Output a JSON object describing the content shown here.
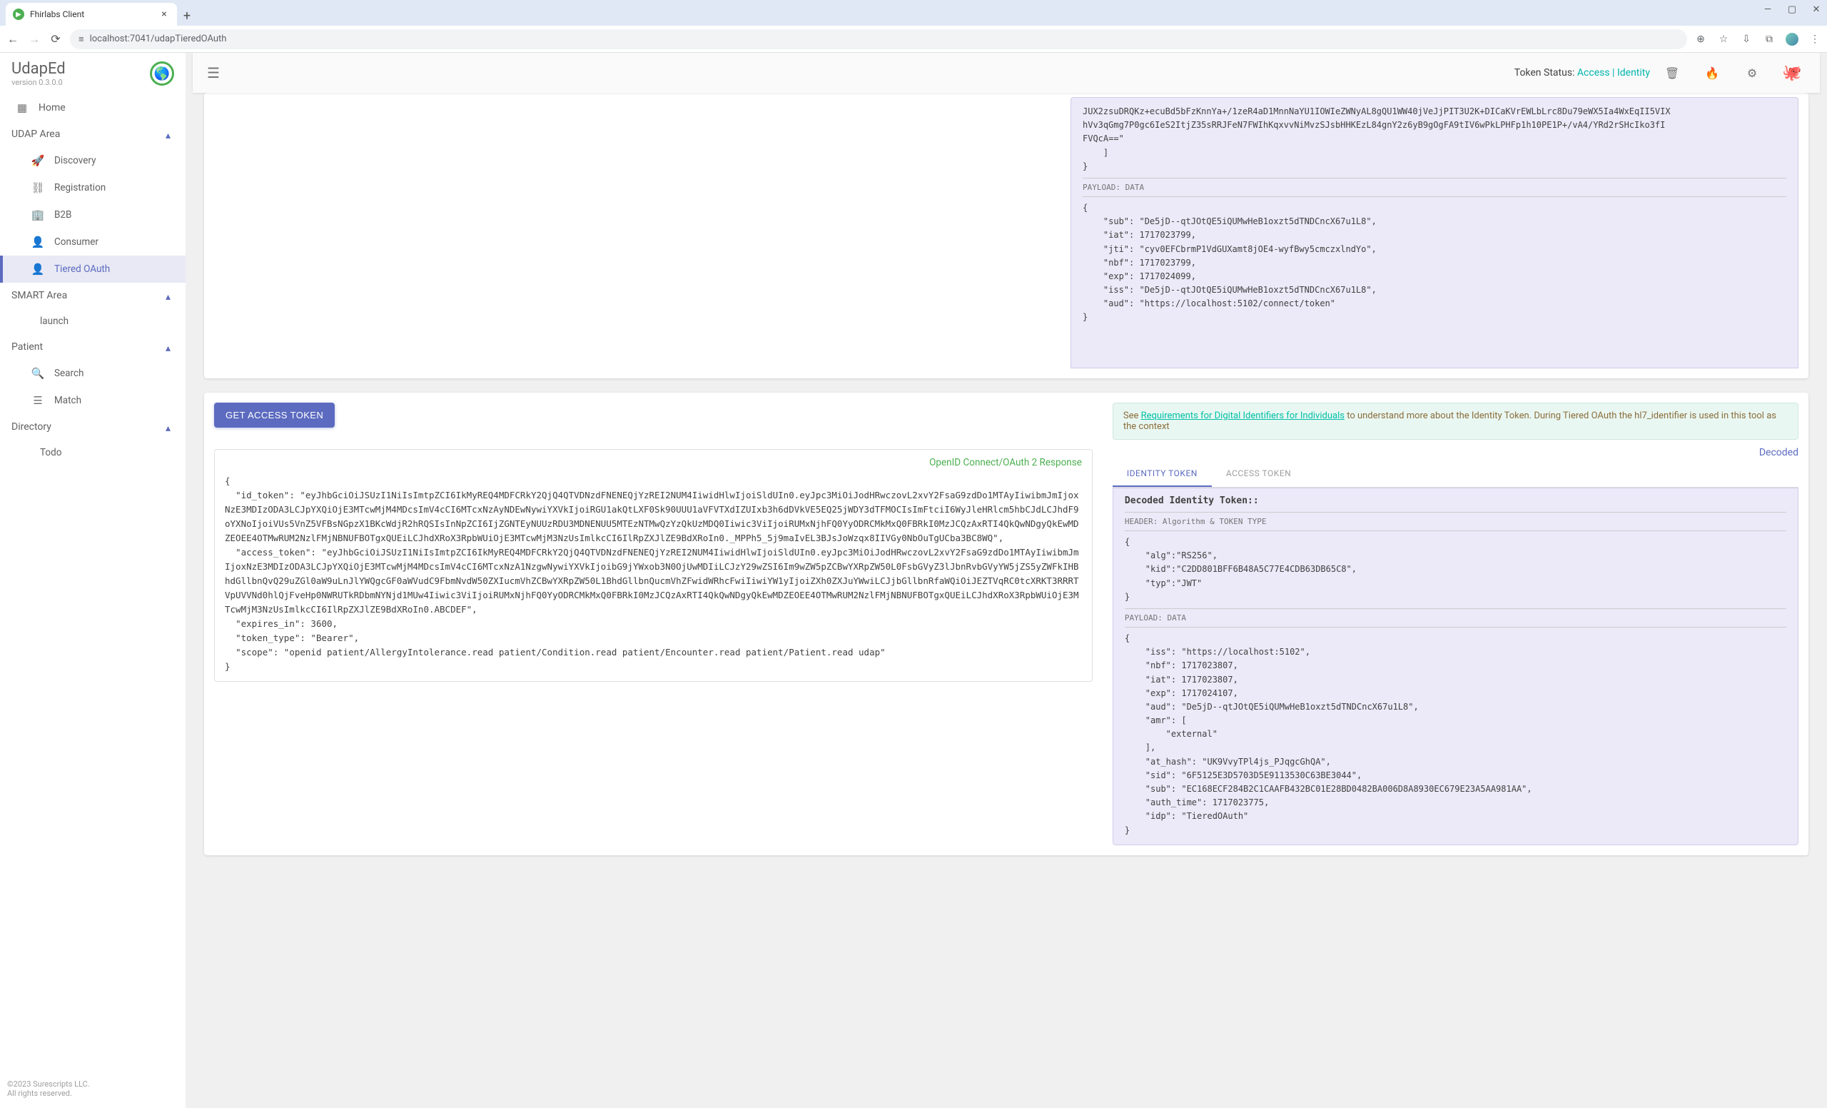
{
  "browser": {
    "tab_title": "Fhirlabs Client",
    "url": "localhost:7041/udapTieredOAuth"
  },
  "brand": {
    "name": "UdapEd",
    "version": "version 0.3.0.0"
  },
  "sidebar": {
    "home": "Home",
    "groups": {
      "udap": "UDAP Area",
      "smart": "SMART Area",
      "patient": "Patient",
      "directory": "Directory"
    },
    "items": {
      "discovery": "Discovery",
      "registration": "Registration",
      "b2b": "B2B",
      "consumer": "Consumer",
      "tiered": "Tiered OAuth",
      "launch": "launch",
      "search": "Search",
      "match": "Match",
      "todo": "Todo"
    }
  },
  "footer": {
    "line1": "©2023 Surescripts LLC.",
    "line2": "All rights reserved."
  },
  "appbar": {
    "token_status_label": "Token Status: ",
    "token_status_value": "Access | Identity"
  },
  "top_decoded": {
    "sig_fragment": "JUX2zsuDRQKz+ecuBd5bFzKnnYa+/1zeR4aD1MnnNaYU1IOWIeZWNyAL8gQU1WW40jVeJjPIT3U2K+DICaKVrEWLbLrc8Du79eWX5Ia4WxEqII5VIX\nhVv3qGmg7P0gc6IeS2ItjZ35sRRJFeN7FWIhKqxvvNiMvzSJsbHHKEzL84gnY2z6yB9gOgFA9tIV6wPkLPHFp1h10PE1P+/vA4/YRd2rSHcIko3fI\nFVQcA==\"\n    ]\n}",
    "payload_label": "PAYLOAD: DATA",
    "payload_json": "{\n    \"sub\": \"De5jD--qtJOtQE5iQUMwHeB1oxzt5dTNDCncX67u1L8\",\n    \"iat\": 1717023799,\n    \"jti\": \"cyv0EFCbrmP1VdGUXamt8jOE4-wyfBwy5cmczxlndYo\",\n    \"nbf\": 1717023799,\n    \"exp\": 1717024099,\n    \"iss\": \"De5jD--qtJOtQE5iQUMwHeB1oxzt5dTNDCncX67u1L8\",\n    \"aud\": \"https://localhost:5102/connect/token\"\n}"
  },
  "get_token": {
    "button": "GET ACCESS TOKEN"
  },
  "oauth_response": {
    "title": "OpenID Connect/OAuth 2 Response",
    "json": "{\n  \"id_token\": \"eyJhbGciOiJSUzI1NiIsImtpZCI6IkMyREQ4MDFCRkY2QjQ4QTVDNzdFNENEQjYzREI2NUM4IiwidHlwIjoiSldUIn0.eyJpc3MiOiJodHRwczovL2xvY2FsaG9zdDo1MTAyIiwibmJmIjoxNzE3MDIzODA3LCJpYXQiOjE3MTcwMjM4MDcsImV4cCI6MTcxNzAyNDEwNywiYXVkIjoiRGU1akQtLXF0Sk90UUU1aVFVTXdIZUIxb3h6dDVkVE5EQ25jWDY3dTFMOCIsImFtciI6WyJleHRlcm5hbCJdLCJhdF9oYXNoIjoiVUs5VnZ5VFBsNGpzX1BKcWdjR2hRQSIsInNpZCI6IjZGNTEyNUUzRDU3MDNENUU5MTEzNTMwQzYzQkUzMDQ0Iiwic3ViIjoiRUMxNjhFQ0YyODRCMkMxQ0FBRkI0MzJCQzAxRTI4QkQwNDgyQkEwMDZEOEE4OTMwRUM2NzlFMjNBNUFBOTgxQUEiLCJhdXRoX3RpbWUiOjE3MTcwMjM3NzUsImlkcCI6IlRpZXJlZE9BdXRoIn0._MPPh5_5j9maIvEL3BJsJoWzqx8IIVGy0NbOuTgUCba3BC8WQ\",\n  \"access_token\": \"eyJhbGciOiJSUzI1NiIsImtpZCI6IkMyREQ4MDFCRkY2QjQ4QTVDNzdFNENEQjYzREI2NUM4IiwidHlwIjoiSldUIn0.eyJpc3MiOiJodHRwczovL2xvY2FsaG9zdDo1MTAyIiwibmJmIjoxNzE3MDIzODA3LCJpYXQiOjE3MTcwMjM4MDcsImV4cCI6MTcxNzA1NzgwNywiYXVkIjoibG9jYWxob3N0OjUwMDIiLCJzY29wZSI6Im9wZW5pZCBwYXRpZW50L0FsbGVyZ3lJbnRvbGVyYW5jZS5yZWFkIHBhdGllbnQvQ29uZGl0aW9uLnJlYWQgcGF0aWVudC9FbmNvdW50ZXIucmVhZCBwYXRpZW50L1BhdGllbnQucmVhZFwidWRhcFwiIiwiYW1yIjoiZXh0ZXJuYWwiLCJjbGllbnRfaWQiOiJEZTVqRC0tcXRKT3RRRTVpUVVNd0hlQjFveHp0NWRUTkRDbmNYNjd1MUw4Iiwic3ViIjoiRUMxNjhFQ0YyODRCMkMxQ0FBRkI0MzJCQzAxRTI4QkQwNDgyQkEwMDZEOEE4OTMwRUM2NzlFMjNBNUFBOTgxQUEiLCJhdXRoX3RpbWUiOjE3MTcwMjM3NzUsImlkcCI6IlRpZXJlZE9BdXRoIn0.ABCDEF\",\n  \"expires_in\": 3600,\n  \"token_type\": \"Bearer\",\n  \"scope\": \"openid patient/AllergyIntolerance.read patient/Condition.read patient/Encounter.read patient/Patient.read udap\"\n}"
  },
  "alert": {
    "prefix": "See ",
    "link": "Requirements for Digital Identifiers for Individuals",
    "suffix": " to understand more about the Identity Token. During Tiered OAuth the hl7_identifier is used in this tool as the context"
  },
  "decoded_label": "Decoded",
  "tabs": {
    "identity": "IDENTITY TOKEN",
    "access": "ACCESS TOKEN"
  },
  "decoded_panel": {
    "title": "Decoded Identity Token::",
    "header_label": "HEADER: Algorithm & TOKEN TYPE",
    "header_json": "{\n    \"alg\":\"RS256\",\n    \"kid\":\"C2DD801BFF6B48A5C77E4CDB63DB65C8\",\n    \"typ\":\"JWT\"\n}",
    "payload_label": "PAYLOAD: DATA",
    "payload_json": "{\n    \"iss\": \"https://localhost:5102\",\n    \"nbf\": 1717023807,\n    \"iat\": 1717023807,\n    \"exp\": 1717024107,\n    \"aud\": \"De5jD--qtJOtQE5iQUMwHeB1oxzt5dTNDCncX67u1L8\",\n    \"amr\": [\n        \"external\"\n    ],\n    \"at_hash\": \"UK9VvyTPl4js_PJqgcGhQA\",\n    \"sid\": \"6F5125E3D5703D5E9113530C63BE3044\",\n    \"sub\": \"EC168ECF284B2C1CAAFB432BC01E28BD0482BA006D8A8930EC679E23A5AA981AA\",\n    \"auth_time\": 1717023775,\n    \"idp\": \"TieredOAuth\"\n}"
  }
}
